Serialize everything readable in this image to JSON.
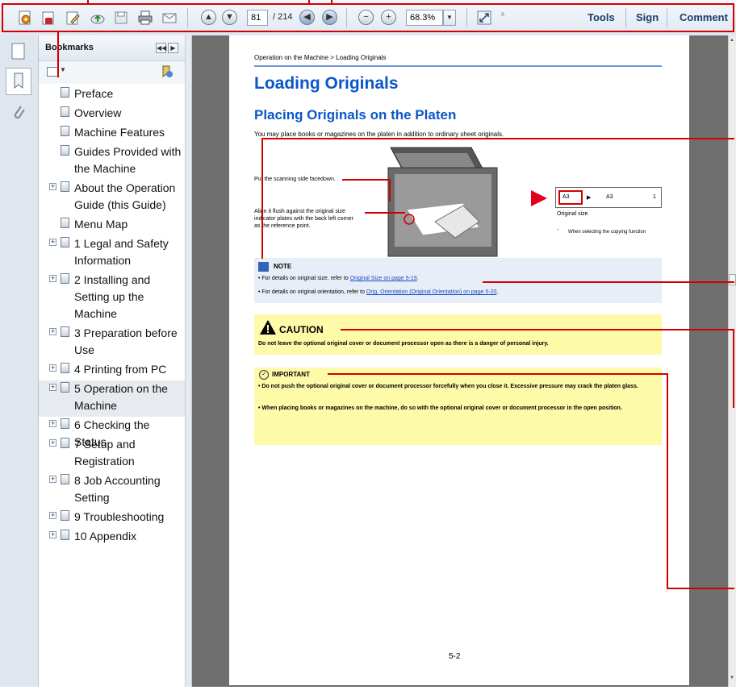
{
  "toolbar": {
    "page_current": "81",
    "page_total": "/ 214",
    "zoom": "68.3%",
    "tools_label": "Tools",
    "sign_label": "Sign",
    "comment_label": "Comment",
    "icons": [
      "create-pdf-icon",
      "open-icon",
      "edit-icon",
      "cloud-upload-icon",
      "save-icon",
      "print-icon",
      "email-icon",
      "previous-page-icon",
      "next-page-icon",
      "back-view-icon",
      "forward-view-icon",
      "zoom-out-icon",
      "zoom-in-icon",
      "fit-window-icon"
    ]
  },
  "bookmarks": {
    "title": "Bookmarks",
    "items": [
      {
        "label": "Preface",
        "expandable": false
      },
      {
        "label": "Overview",
        "expandable": false
      },
      {
        "label": "Machine Features",
        "expandable": false
      },
      {
        "label": "Guides Provided with the Machine",
        "expandable": false
      },
      {
        "label": "About the Operation Guide (this Guide)",
        "expandable": true
      },
      {
        "label": "Menu Map",
        "expandable": false
      },
      {
        "label": "1 Legal and Safety Information",
        "expandable": true
      },
      {
        "label": "2 Installing and Setting up the Machine",
        "expandable": true
      },
      {
        "label": "3 Preparation before Use",
        "expandable": true
      },
      {
        "label": "4 Printing from PC",
        "expandable": true
      },
      {
        "label": "5 Operation on the Machine",
        "expandable": true,
        "selected": true
      },
      {
        "label": "6 Checking the Status",
        "expandable": true
      },
      {
        "label": "7 Setup and Registration",
        "expandable": true
      },
      {
        "label": "8 Job Accounting Setting",
        "expandable": true
      },
      {
        "label": "9 Troubleshooting",
        "expandable": true
      },
      {
        "label": "10 Appendix",
        "expandable": true
      }
    ]
  },
  "page": {
    "breadcrumb": "Operation on the Machine > Loading Originals",
    "title": "Loading Originals",
    "subtitle": "Placing Originals on the Platen",
    "intro": "You may place books or magazines on the platen in addition to ordinary sheet originals.",
    "figure": {
      "label1": "Put the scanning side facedown.",
      "label2": "Align it flush against the original size indicator plates with the back left corner as the reference point.",
      "panel_a": "A3",
      "panel_b": "A3",
      "panel_num": "1",
      "original_size": "Original size",
      "copy_note": "When selecting the copying function",
      "bullet": "-"
    },
    "note": {
      "heading": "NOTE",
      "line1_prefix": "• For details on original size, refer to ",
      "line1_link": "Original Size on page 5-19",
      "line1_suffix": ".",
      "line2_prefix": "• For details on original orientation, refer to ",
      "line2_link": "Orig. Orientation (Original Orientation) on page 5-20",
      "line2_suffix": "."
    },
    "caution": {
      "heading": "CAUTION",
      "body": "Do not leave the optional original cover or document processor open as there is a danger of personal injury."
    },
    "important": {
      "heading": "IMPORTANT",
      "item1": "• Do not push the optional original cover or document processor forcefully when you close it. Excessive pressure may crack the platen glass.",
      "item2": "• When placing books or magazines on the machine, do so with the optional original cover or document processor in the open position."
    },
    "page_number": "5-2"
  },
  "colors": {
    "heading_blue": "#0b57c8",
    "callout_red": "#d20000",
    "note_bg": "#e8eef7",
    "warn_bg": "#fdfaa8",
    "link_blue": "#1a4cc8"
  }
}
